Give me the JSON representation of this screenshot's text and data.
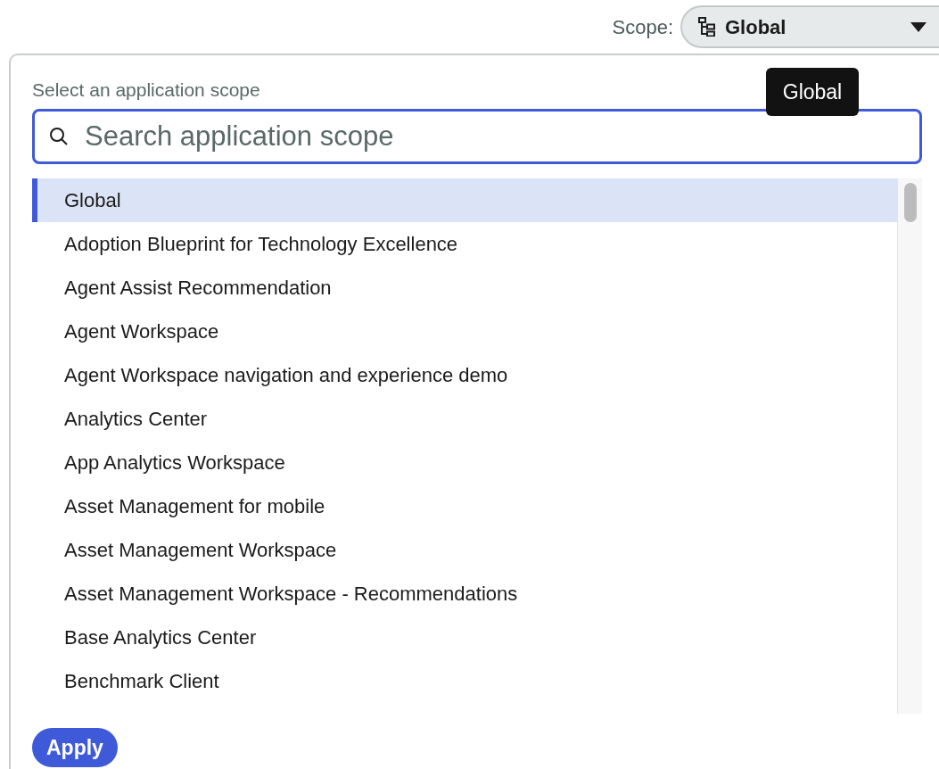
{
  "scope_picker": {
    "label": "Scope:",
    "value": "Global",
    "tooltip": "Global"
  },
  "panel": {
    "heading": "Select an application scope",
    "search": {
      "placeholder": "Search application scope"
    },
    "items": [
      {
        "label": "Global",
        "selected": true
      },
      {
        "label": "Adoption Blueprint for Technology Excellence",
        "selected": false
      },
      {
        "label": "Agent Assist Recommendation",
        "selected": false
      },
      {
        "label": "Agent Workspace",
        "selected": false
      },
      {
        "label": "Agent Workspace navigation and experience demo",
        "selected": false
      },
      {
        "label": "Analytics Center",
        "selected": false
      },
      {
        "label": "App Analytics Workspace",
        "selected": false
      },
      {
        "label": "Asset Management for mobile",
        "selected": false
      },
      {
        "label": "Asset Management Workspace",
        "selected": false
      },
      {
        "label": "Asset Management Workspace - Recommendations",
        "selected": false
      },
      {
        "label": "Base Analytics Center",
        "selected": false
      },
      {
        "label": "Benchmark Client",
        "selected": false
      }
    ],
    "apply_button": "Apply"
  }
}
